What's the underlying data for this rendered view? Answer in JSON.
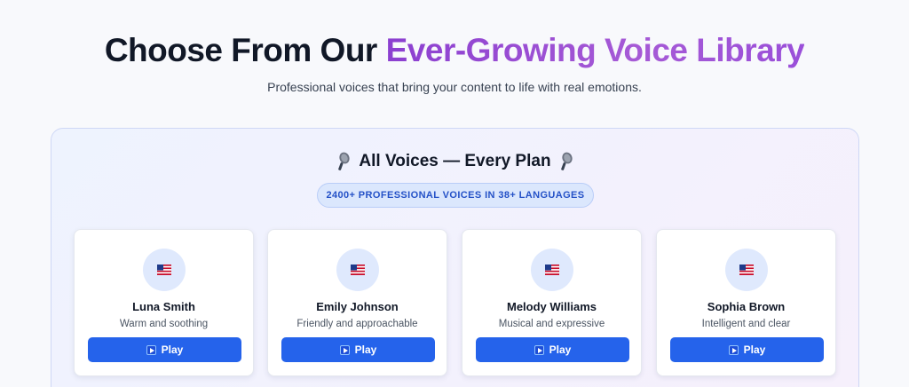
{
  "hero": {
    "title_prefix": "Choose From Our ",
    "title_accent": "Ever-Growing Voice Library",
    "subtitle": "Professional voices that bring your content to life with real emotions."
  },
  "library": {
    "title": "All Voices — Every Plan",
    "badge": "2400+ PROFESSIONAL VOICES IN 38+ LANGUAGES",
    "voices": [
      {
        "name": "Luna Smith",
        "description": "Warm and soothing",
        "flag": "us-flag-icon",
        "play_label": "Play"
      },
      {
        "name": "Emily Johnson",
        "description": "Friendly and approachable",
        "flag": "us-flag-icon",
        "play_label": "Play"
      },
      {
        "name": "Melody Williams",
        "description": "Musical and expressive",
        "flag": "us-flag-icon",
        "play_label": "Play"
      },
      {
        "name": "Sophia Brown",
        "description": "Intelligent and clear",
        "flag": "us-flag-icon",
        "play_label": "Play"
      }
    ]
  },
  "colors": {
    "accent_purple": "#9a4fd9",
    "play_button": "#2563eb",
    "badge_text": "#2451c7"
  }
}
